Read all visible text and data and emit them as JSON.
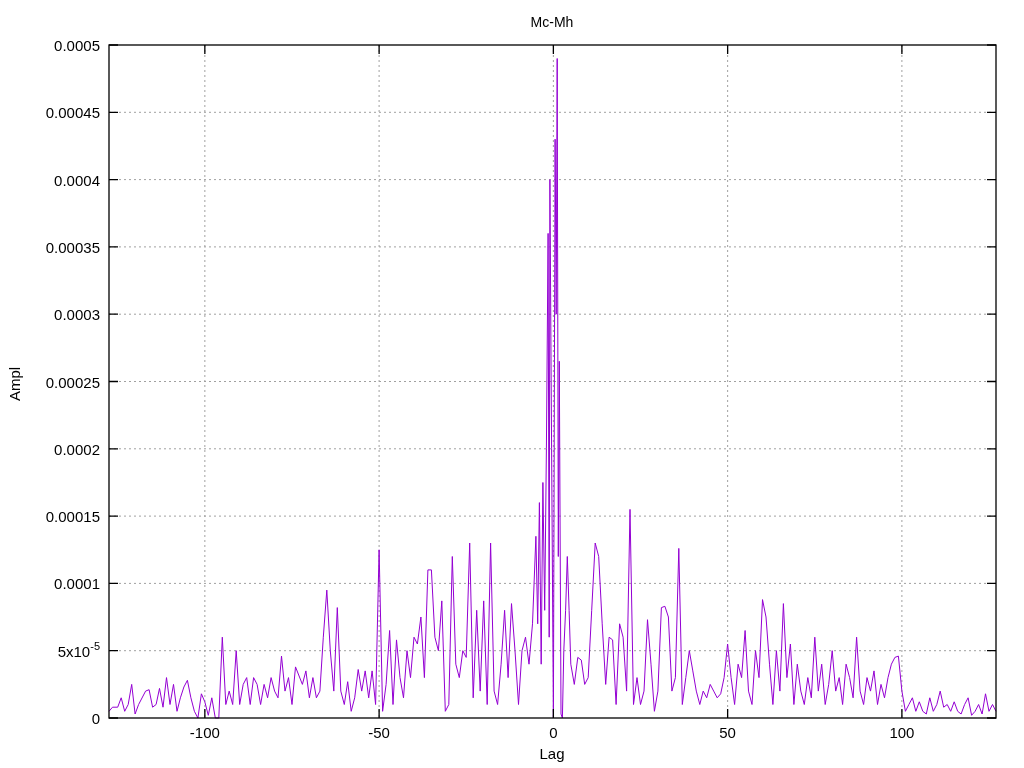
{
  "plot": {
    "chart_data": {
      "type": "line",
      "title": "Mc-Mh",
      "xlabel": "Lag",
      "ylabel": "Ampl",
      "grid": true,
      "xlim": [
        -127.5,
        127
      ],
      "ylim": [
        0,
        0.0005
      ],
      "xticks": [
        {
          "value": -100,
          "label": "-100"
        },
        {
          "value": -50,
          "label": "-50"
        },
        {
          "value": 0,
          "label": "0"
        },
        {
          "value": 50,
          "label": "50"
        },
        {
          "value": 100,
          "label": "100"
        }
      ],
      "yticks": [
        {
          "value": 0,
          "label": "0"
        },
        {
          "value": 5e-05,
          "label": "5x10$^{-5}$"
        },
        {
          "value": 0.0001,
          "label": "0.0001"
        },
        {
          "value": 0.00015,
          "label": "0.00015"
        },
        {
          "value": 0.0002,
          "label": "0.0002"
        },
        {
          "value": 0.00025,
          "label": "0.00025"
        },
        {
          "value": 0.0003,
          "label": "0.0003"
        },
        {
          "value": 0.00035,
          "label": "0.00035"
        },
        {
          "value": 0.0004,
          "label": "0.0004"
        },
        {
          "value": 0.00045,
          "label": "0.00045"
        },
        {
          "value": 0.0005,
          "label": "0.0005"
        }
      ],
      "x": [
        -127.5,
        -126.5,
        -125,
        -124,
        -123,
        -122,
        -121,
        -120,
        -119,
        -117,
        -116,
        -115,
        -114,
        -113,
        -112,
        -111,
        -110,
        -109,
        -108,
        -107,
        -106,
        -105,
        -104,
        -103,
        -102,
        -101,
        -100,
        -99,
        -98,
        -97,
        -96,
        -95,
        -94,
        -93,
        -92,
        -91,
        -90,
        -89,
        -88,
        -87,
        -86,
        -85,
        -84,
        -83,
        -82,
        -81,
        -80,
        -79,
        -78,
        -77,
        -76,
        -75,
        -74,
        -72,
        -71,
        -70,
        -69,
        -68,
        -67,
        -66,
        -65,
        -64,
        -63,
        -62,
        -61,
        -60,
        -59,
        -58,
        -57,
        -56,
        -55,
        -54,
        -53,
        -52,
        -51,
        -50,
        -49,
        -48,
        -47,
        -46,
        -45,
        -44,
        -43,
        -42,
        -41,
        -40,
        -39,
        -38,
        -37,
        -36,
        -35,
        -34,
        -33,
        -32,
        -31,
        -30,
        -29,
        -28,
        -27,
        -26,
        -25,
        -24,
        -23,
        -22,
        -21,
        -20,
        -19,
        -18,
        -17,
        -16,
        -15,
        -14,
        -13,
        -12,
        -11,
        -10,
        -9,
        -8,
        -7,
        -6,
        -5,
        -4.5,
        -4,
        -3.5,
        -3,
        -2.5,
        -2,
        -1.5,
        -1.2,
        -1,
        -0.5,
        0,
        0.5,
        0.8,
        1.1,
        1.4,
        1.7,
        2.2,
        2.6,
        3,
        3.5,
        4,
        4.5,
        5,
        6,
        7,
        8,
        9,
        10,
        11,
        12,
        13,
        14,
        15,
        16,
        17,
        18,
        19,
        20,
        21,
        22,
        23,
        24,
        25,
        26,
        27,
        28,
        29,
        30,
        31,
        32,
        33,
        34,
        35,
        36,
        37,
        38,
        39,
        40,
        41,
        42,
        43,
        44,
        45,
        46,
        47,
        48,
        49,
        50,
        51,
        52,
        53,
        54,
        55,
        56,
        57,
        58,
        59,
        60,
        61,
        62,
        63,
        64,
        65,
        66,
        67,
        68,
        69,
        70,
        71,
        72,
        73,
        74,
        75,
        76,
        77,
        78,
        79,
        80,
        81,
        82,
        83,
        84,
        85,
        86,
        87,
        88,
        89,
        90,
        91,
        92,
        93,
        94,
        95,
        96,
        97,
        98,
        99,
        100,
        101,
        102,
        103,
        104,
        105,
        106,
        107,
        108,
        109,
        110,
        111,
        112,
        113,
        114,
        115,
        116,
        117,
        118,
        119,
        120,
        121,
        122,
        123,
        124,
        125,
        126,
        127
      ],
      "series": [
        {
          "color": "#9400d3",
          "values": [
            5e-06,
            8e-06,
            8e-06,
            1.5e-05,
            5e-06,
            1e-05,
            2.5e-05,
            3e-06,
            1e-05,
            2e-05,
            2.1e-05,
            8e-06,
            1e-05,
            2.2e-05,
            8e-06,
            3e-05,
            1e-05,
            2.5e-05,
            5e-06,
            1.5e-05,
            2.3e-05,
            2.8e-05,
            1.5e-05,
            5e-06,
            0,
            1.8e-05,
            1.2e-05,
            2e-06,
            1.5e-05,
            0,
            0,
            6e-05,
            1e-05,
            2e-05,
            1e-05,
            5e-05,
            1e-05,
            2.5e-05,
            3e-05,
            1e-05,
            3e-05,
            2.5e-05,
            1e-05,
            2.5e-05,
            1.5e-05,
            3e-05,
            2e-05,
            1.5e-05,
            4.6e-05,
            2e-05,
            3e-05,
            1e-05,
            3.8e-05,
            2.5e-05,
            3.5e-05,
            1.5e-05,
            3e-05,
            1.5e-05,
            2e-05,
            6e-05,
            9.5e-05,
            5e-05,
            2e-05,
            8.2e-05,
            2e-05,
            1e-05,
            2.7e-05,
            5e-06,
            1.5e-05,
            3.6e-05,
            2e-05,
            3.5e-05,
            1.5e-05,
            3.5e-05,
            1e-05,
            0.000125,
            5e-06,
            2.5e-05,
            6.5e-05,
            1e-05,
            5.8e-05,
            3e-05,
            1.5e-05,
            5e-05,
            3e-05,
            6e-05,
            5.5e-05,
            7.5e-05,
            3e-05,
            0.00011,
            0.00011,
            6e-05,
            5e-05,
            8.7e-05,
            5e-06,
            1e-05,
            0.00012,
            4e-05,
            3e-05,
            5e-05,
            4.5e-05,
            0.00013,
            1.5e-05,
            8e-05,
            2e-05,
            8.7e-05,
            1e-05,
            0.00013,
            2e-05,
            1e-05,
            4e-05,
            8e-05,
            3e-05,
            8.5e-05,
            5e-05,
            1e-05,
            5e-05,
            6e-05,
            4e-05,
            7e-05,
            0.000135,
            7e-05,
            0.00016,
            4e-05,
            0.000175,
            8e-05,
            0.0002,
            0.00036,
            6e-05,
            0.0004,
            0.0002,
            0,
            0.00043,
            0.0003,
            0.00049,
            0.00012,
            0.000265,
            3e-06,
            0,
            5e-05,
            8e-05,
            0.00012,
            8e-05,
            4e-05,
            2.5e-05,
            4.5e-05,
            4.3e-05,
            2.5e-05,
            3e-05,
            8e-05,
            0.00013,
            0.00012,
            7e-05,
            2.5e-05,
            6e-05,
            5.8e-05,
            1e-05,
            7e-05,
            6e-05,
            2e-05,
            0.000155,
            1e-05,
            3e-05,
            1e-05,
            2e-05,
            7.3e-05,
            4e-05,
            5e-06,
            2e-05,
            8.2e-05,
            8.3e-05,
            7.5e-05,
            2e-05,
            3e-05,
            0.000126,
            1e-05,
            3e-05,
            5e-05,
            3.5e-05,
            2e-05,
            1e-05,
            2e-05,
            1.5e-05,
            2.5e-05,
            2e-05,
            1.5e-05,
            1.8e-05,
            3e-05,
            5.5e-05,
            3e-05,
            1e-05,
            4e-05,
            3e-05,
            6.5e-05,
            2e-05,
            1e-05,
            5e-05,
            3e-05,
            8.8e-05,
            7.5e-05,
            4e-05,
            1e-05,
            5e-05,
            2e-05,
            8.5e-05,
            3e-05,
            5.5e-05,
            1e-05,
            4e-05,
            2e-05,
            1e-05,
            3e-05,
            1.5e-05,
            6e-05,
            2e-05,
            4e-05,
            1e-05,
            2.5e-05,
            5e-05,
            2e-05,
            3e-05,
            1e-05,
            4e-05,
            3e-05,
            1.5e-05,
            6e-05,
            2e-05,
            1e-05,
            3e-05,
            2e-05,
            3.5e-05,
            1e-05,
            2.5e-05,
            1.5e-05,
            3e-05,
            4e-05,
            4.5e-05,
            4.6e-05,
            2e-05,
            5e-06,
            1e-05,
            1.5e-05,
            5e-06,
            1.2e-05,
            5e-06,
            3e-06,
            1.5e-05,
            5e-06,
            1e-05,
            2e-05,
            8e-06,
            1e-05,
            5e-06,
            1.2e-05,
            5e-06,
            3e-06,
            1e-05,
            1.5e-05,
            2e-06,
            5e-06,
            1e-05,
            3e-06,
            1.8e-05,
            5e-06,
            1e-05,
            5e-06
          ]
        }
      ]
    }
  }
}
